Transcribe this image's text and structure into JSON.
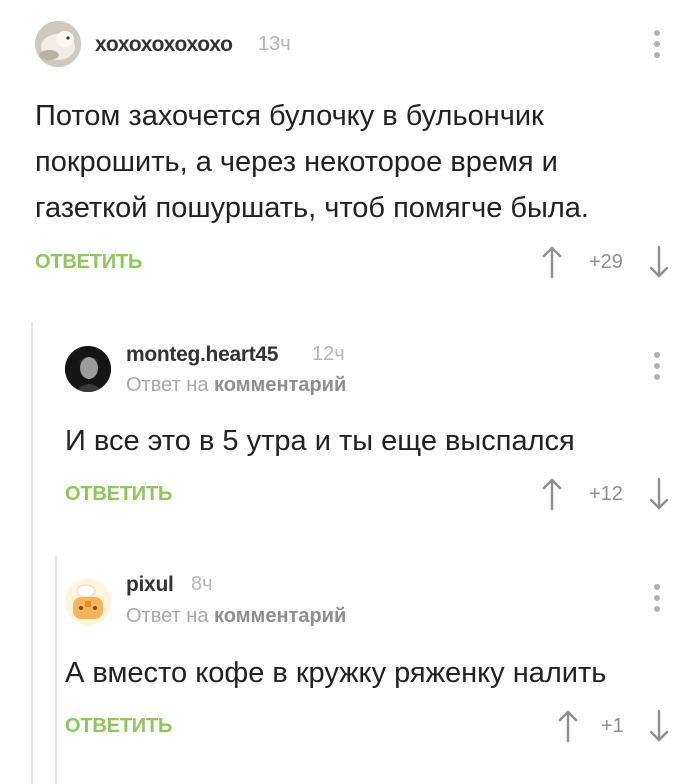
{
  "comments": [
    {
      "author": "хохохохохохо",
      "time": "13ч",
      "text_lines": [
        "Потом захочется булочку в бульончик",
        "покрошить, а через некоторое время и",
        "газеткой пошуршать, чтоб помягче была."
      ],
      "reply_label": "ОТВЕТИТЬ",
      "rating": "+29"
    },
    {
      "author": "monteg.heart45",
      "time": "12ч",
      "reply_to_prefix": "Ответ на",
      "reply_to_target": "комментарий",
      "text": "И все это в 5 утра и ты еще выспался",
      "reply_label": "ОТВЕТИТЬ",
      "rating": "+12"
    },
    {
      "author": "pixul",
      "time": "8ч",
      "reply_to_prefix": "Ответ на",
      "reply_to_target": "комментарий",
      "text": "А вместо кофе в кружку ряженку налить",
      "reply_label": "ОТВЕТИТЬ",
      "rating": "+1"
    }
  ],
  "icons": {
    "upvote": "arrow-up-icon",
    "downvote": "arrow-down-icon",
    "more": "more-vertical-icon"
  },
  "colors": {
    "reply_green": "#8ac858",
    "muted_gray": "#b5b5b5",
    "thread_line": "#e5e5e5"
  }
}
